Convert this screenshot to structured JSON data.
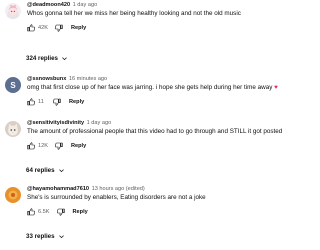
{
  "comments": [
    {
      "username": "@deadmoon420",
      "time": "1 day ago",
      "text": "Whos gonna tell her we miss her being healthy looking and not the old music",
      "likes": "42K",
      "reply_label": "Reply",
      "replies_label": "324 replies",
      "avatar": "anime-avatar"
    },
    {
      "username": "@ssnowsbunx",
      "time": "16 minutes ago",
      "text": "omg that first close up of her face was jarring. i hope she gets help during her time away",
      "emoji": "♥",
      "likes": "11",
      "reply_label": "Reply",
      "avatar_letter": "S",
      "avatar_color": "#5c6f91"
    },
    {
      "username": "@sensitivityisdivinity",
      "time": "1 day ago",
      "text": "The amount of professional people that this video had to go through and STILL it got posted",
      "likes": "12K",
      "reply_label": "Reply",
      "replies_label": "64 replies",
      "avatar": "cat-avatar"
    },
    {
      "username": "@hayamohammad7610",
      "time": "13 hours ago (edited)",
      "text": "She's is surrounded by enablers, Eating disorders are not a joke",
      "likes": "6.5K",
      "reply_label": "Reply",
      "replies_label": "33 replies",
      "avatar": "orange-avatar"
    }
  ],
  "icons": {
    "like": "thumbs-up-icon",
    "dislike": "thumbs-down-icon",
    "expand": "chevron-down-icon"
  },
  "colors": {
    "text": "#0f0f0f",
    "secondary": "#606060",
    "heart": "#d6336c"
  }
}
